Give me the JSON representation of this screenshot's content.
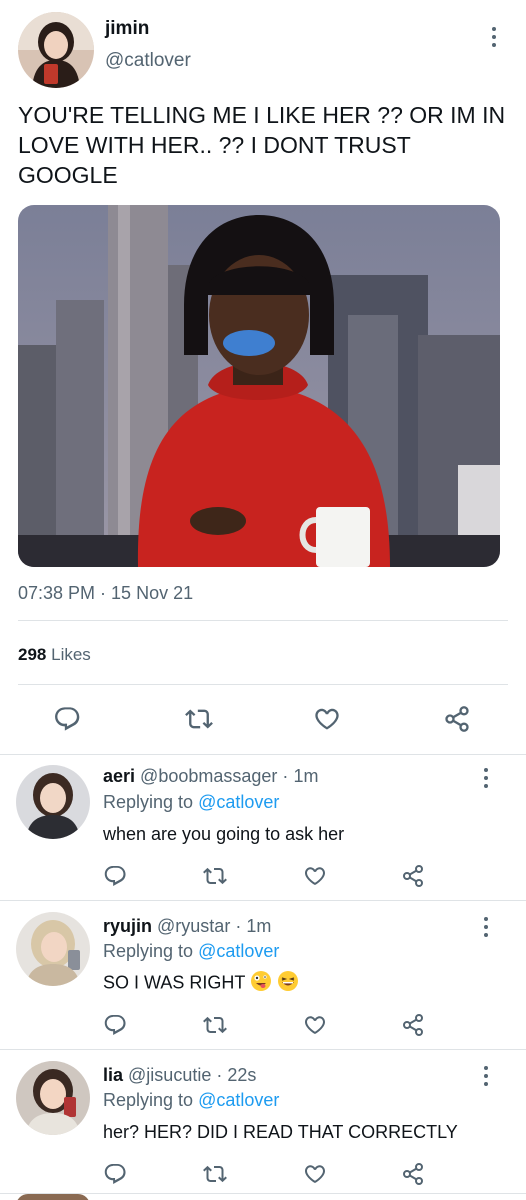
{
  "main_tweet": {
    "author_name": "jimin",
    "author_handle": "@catlover",
    "text": "YOU'RE TELLING ME I LIKE HER ?? OR IM IN LOVE WITH HER.. ?? I DONT TRUST GOOGLE",
    "timestamp": "07:38 PM · 15 Nov 21",
    "likes_count": "298",
    "likes_label": "Likes"
  },
  "replies": [
    {
      "name": "aeri",
      "handle": "@boobmassager",
      "separator": "·",
      "time": "1m",
      "replying_prefix": "Replying to",
      "replying_to": "@catlover",
      "text": "when are you going to ask her"
    },
    {
      "name": "ryujin",
      "handle": "@ryustar",
      "separator": "·",
      "time": "1m",
      "replying_prefix": "Replying to",
      "replying_to": "@catlover",
      "text": "SO I WAS RIGHT",
      "emojis": [
        "zany-face-emoji",
        "grinning-squint-emoji"
      ]
    },
    {
      "name": "lia",
      "handle": "@jisucutie",
      "separator": "·",
      "time": "22s",
      "replying_prefix": "Replying to",
      "replying_to": "@catlover",
      "text": "her? HER? DID I READ THAT CORRECTLY"
    }
  ],
  "icons": [
    "reply-icon",
    "retweet-icon",
    "like-icon",
    "share-icon",
    "more-options-icon"
  ],
  "colors": {
    "text": "#0f1419",
    "secondary": "#536471",
    "accent": "#1d9bf0",
    "divider": "#dfe3e6"
  }
}
